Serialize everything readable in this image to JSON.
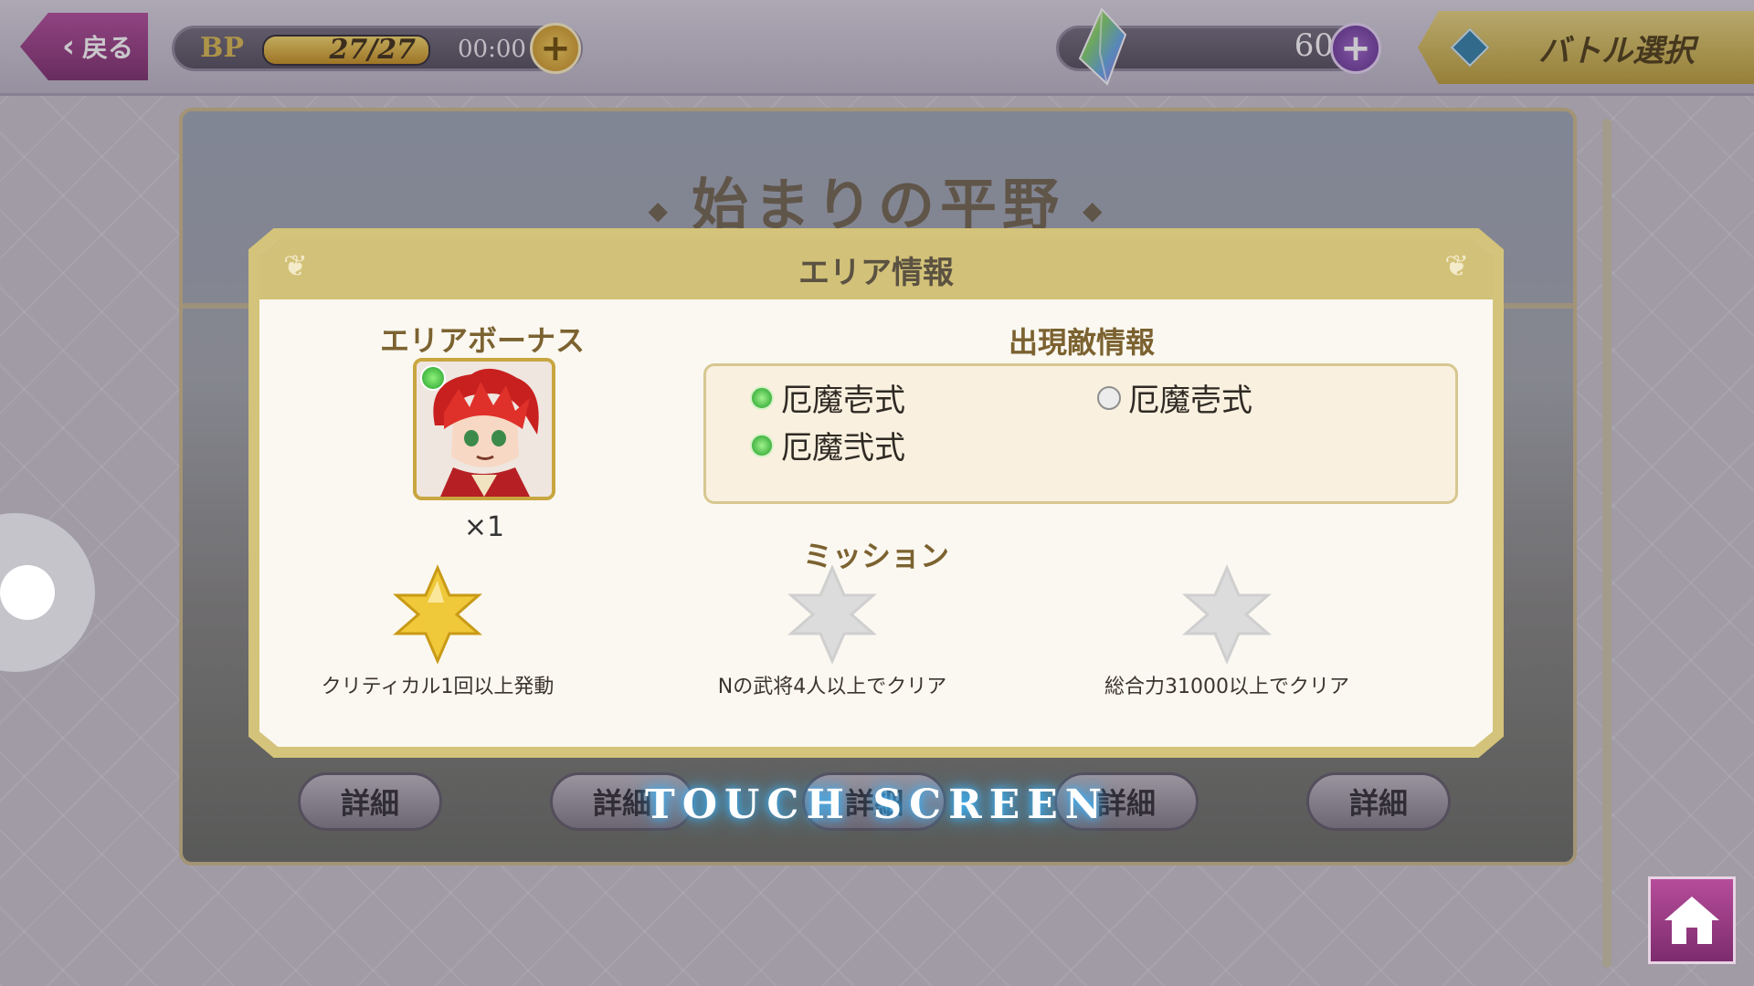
{
  "topbar": {
    "back_label": "戻る",
    "bp_label": "BP",
    "bp_value": "27/27",
    "bp_fill": 1.0,
    "bp_timer": "00:00",
    "gem_value": "60",
    "battle_select_label": "バトル選択"
  },
  "stage": {
    "title": "始まりの平野",
    "detail_buttons": [
      "詳細",
      "詳細",
      "詳細",
      "詳細",
      "詳細"
    ],
    "overlay_text": "TOUCH SCREEN"
  },
  "modal": {
    "header": "エリア情報",
    "bonus_title": "エリアボーナス",
    "bonus_count": "×1",
    "enemy_title": "出現敵情報",
    "enemies": [
      {
        "name": "厄魔壱式",
        "status": "on"
      },
      {
        "name": "厄魔壱式",
        "status": "off"
      },
      {
        "name": "厄魔弐式",
        "status": "on"
      }
    ],
    "mission_title": "ミッション",
    "missions": [
      {
        "text": "クリティカル1回以上発動",
        "achieved": true
      },
      {
        "text": "Nの武将4人以上でクリア",
        "achieved": false
      },
      {
        "text": "総合力31000以上でクリア",
        "achieved": false
      }
    ]
  },
  "colors": {
    "accent_gold": "#d2c178",
    "accent_purple": "#7d2c6f",
    "star_gold": "#f0c93a",
    "star_gray": "#dcdcdc",
    "glow_blue": "#39b6ff"
  }
}
